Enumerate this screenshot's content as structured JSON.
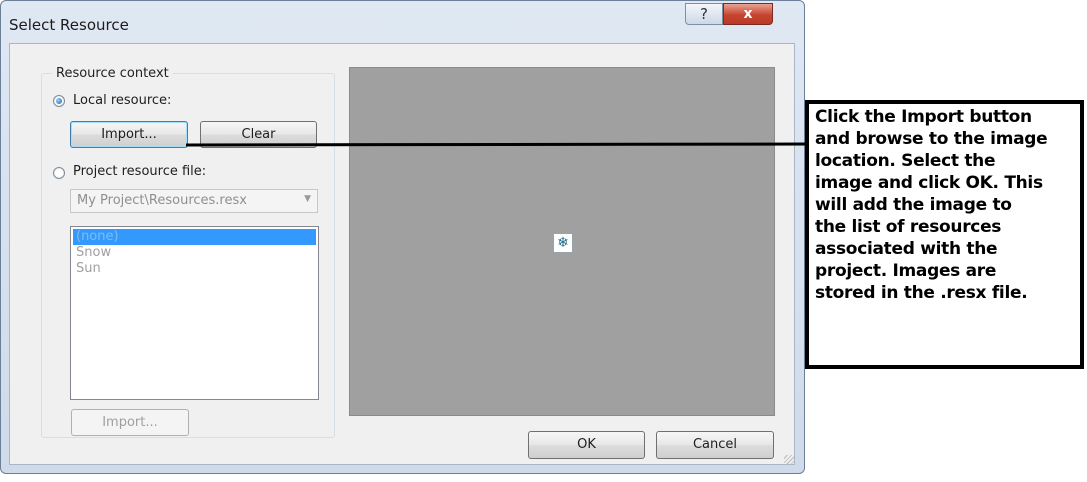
{
  "window": {
    "title": "Select Resource",
    "help_glyph": "?",
    "close_glyph": "x"
  },
  "resource_context": {
    "legend": "Resource context",
    "local": {
      "label": "Local resource:",
      "checked": true,
      "import_label": "Import...",
      "clear_label": "Clear"
    },
    "project": {
      "label": "Project resource file:",
      "checked": false,
      "combo_value": "My Project\\Resources.resx",
      "items": [
        "(none)",
        "Snow",
        "Sun"
      ],
      "selected_index": 0,
      "import_label": "Import..."
    }
  },
  "preview": {
    "icon": "snowflake-icon",
    "glyph": "❄"
  },
  "buttons": {
    "ok": "OK",
    "cancel": "Cancel"
  },
  "annotation": {
    "lines": [
      "Click the Import button",
      "and browse to the image",
      "location.  Select the",
      "image and click OK.  This",
      "will add the image to",
      "the list of resources",
      "associated with the",
      "project.  Images are",
      "stored in the .resx file."
    ]
  },
  "colors": {
    "selection": "#3399ff",
    "preview_bg": "#a0a0a0",
    "close": "#c64530"
  }
}
